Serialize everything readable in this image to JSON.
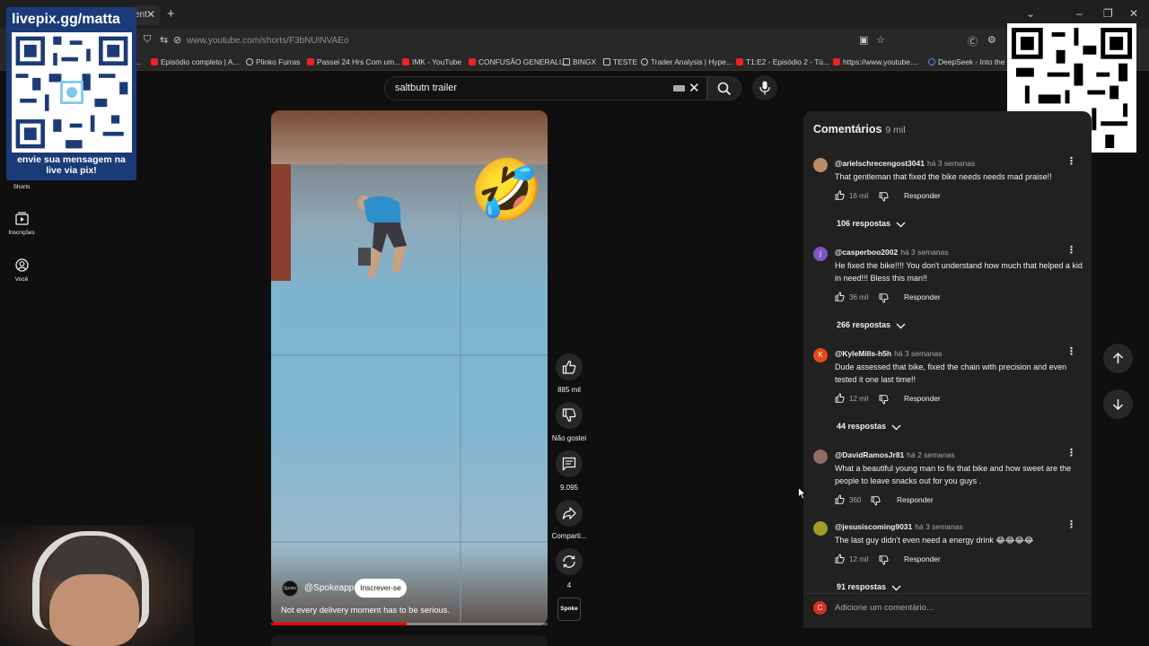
{
  "browser": {
    "tab_title": "ent",
    "url_host": "www.youtube.com",
    "url_path": "/shorts/F3bNUINVAEo",
    "bookmarks": [
      "Episódio completo | A...",
      "Plinko Furras",
      "Passei 24 Hrs Com um...",
      "IMK - YouTube",
      "CONFUSÃO GENERALI...",
      "BINGX",
      "TESTE",
      "Trader Analysis | Hype...",
      "T1:E2 - Episódio 2 - Tú...",
      "https://www.youtube....",
      "DeepSeek - Into the U..."
    ]
  },
  "search": {
    "query": "saltbutn trailer"
  },
  "sidebar": {
    "items": [
      {
        "label": "Shorts"
      },
      {
        "label": "Inscrições"
      },
      {
        "label": "Você"
      }
    ]
  },
  "overlay": {
    "qr_title": "livepix.gg/matta",
    "qr_caption": "envie sua mensagem na live via pix!"
  },
  "short": {
    "channel": "@Spokeapp",
    "channel_avatar_text": "Spoke",
    "subscribe_label": "Inscrever-se",
    "caption": "Not every delivery moment has to be serious.",
    "progress": 0.49,
    "emoji": "🤣"
  },
  "actions": {
    "likes": "885 mil",
    "dislike_label": "Não gostei",
    "comments": "9.095",
    "share_label": "Comparti...",
    "remix": "4",
    "sound_label": "Spoke"
  },
  "comments_panel": {
    "title": "Comentários",
    "count": "9 mil",
    "reply_label": "Responder",
    "add_placeholder": "Adicione um comentário...",
    "user_initial": "C",
    "comments": [
      {
        "author": "@arielschrecengost3041",
        "time": "há 3 semanas",
        "text": "That gentleman that fixed the bike needs needs mad praise!!",
        "likes": "16 mil",
        "replies": "106 respostas",
        "avatar_color": "#b98c6a",
        "avatar_letter": ""
      },
      {
        "author": "@casperboo2002",
        "time": "há 3 semanas",
        "text": "He fixed the bike!!!!  You don't understand how much that helped a kid in need!!! Bless this man!!",
        "likes": "36 mil",
        "replies": "266 respostas",
        "avatar_color": "#7e57c2",
        "avatar_letter": "j"
      },
      {
        "author": "@KyleMills-h5h",
        "time": "há 3 semanas",
        "text": "Dude assessed that bike, fixed the chain with precision and even tested it one last time!!",
        "likes": "12 mil",
        "replies": "44 respostas",
        "avatar_color": "#e64a19",
        "avatar_letter": "K"
      },
      {
        "author": "@DavidRamosJr81",
        "time": "há 2 semanas",
        "text": "What a beautiful young man to fix that bike and how sweet are the people to leave snacks out for you guys .",
        "likes": "360",
        "replies": "",
        "avatar_color": "#8d6e63",
        "avatar_letter": ""
      },
      {
        "author": "@jesusiscoming9031",
        "time": "há 3 semanas",
        "text": "The last guy didn't even need a energy drink 😂😂😂😂",
        "likes": "12 mil",
        "replies": "91 respostas",
        "avatar_color": "#9e9d24",
        "avatar_letter": ""
      }
    ]
  }
}
